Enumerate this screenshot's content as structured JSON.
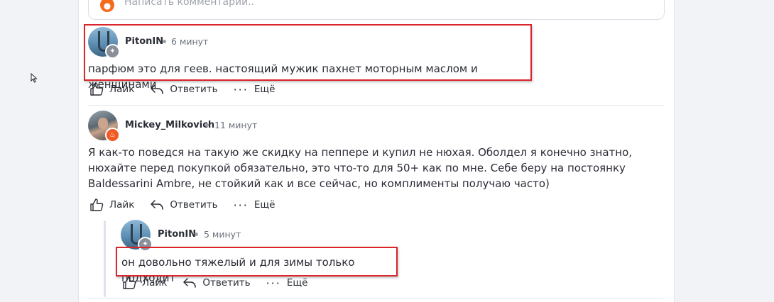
{
  "comment_input": {
    "placeholder": "Написать комментарий.."
  },
  "comments": [
    {
      "author": "PitonIN",
      "time": "6 минут",
      "text": "парфюм это для геев. настоящий мужик пахнет моторным маслом и женщинами",
      "actions": {
        "like": "Лайк",
        "reply": "Ответить",
        "more": "Ещё"
      }
    },
    {
      "author": "Mickey_Milkovich",
      "time": "11 минут",
      "text": "Я как-то поведся на такую же скидку на пеппере и купил не нюхая. Оболдел я конечно знатно, нюхайте перед покупкой обязательно, это что-то для 50+ как по мне. Себе беру на постоянку Baldessarini Ambre, не стойкий как и все сейчас, но комплименты получаю часто)",
      "actions": {
        "like": "Лайк",
        "reply": "Ответить",
        "more": "Ещё"
      },
      "replies": [
        {
          "author": "PitonIN",
          "time": "5 минут",
          "text": "он довольно тяжелый  и для зимы только подходит",
          "actions": {
            "like": "Лайк",
            "reply": "Ответить",
            "more": "Ещё"
          }
        }
      ]
    }
  ],
  "colors": {
    "accent_highlight": "#d9252b",
    "badge_fire": "#f05a23",
    "badge_grey": "#8a9099"
  }
}
